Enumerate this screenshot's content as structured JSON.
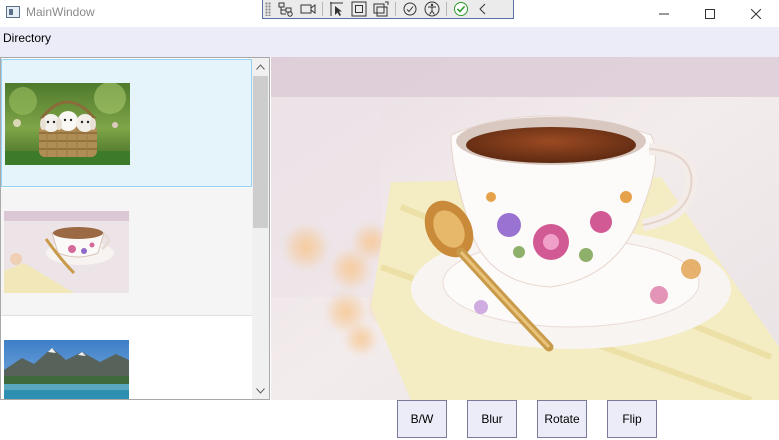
{
  "window": {
    "title": "MainWindow"
  },
  "menu": {
    "items": [
      {
        "label": "Directory"
      }
    ]
  },
  "debug_toolbar": {
    "icons": [
      "live-visual-tree-icon",
      "record-icon",
      "select-element-icon",
      "display-layout-adorner-icon",
      "track-focus-icon",
      "binding-failures-icon",
      "accessibility-icon",
      "checkmark-icon",
      "collapse-icon"
    ]
  },
  "image_list": {
    "items": [
      {
        "thumbnail": "puppies-in-basket",
        "selected": true
      },
      {
        "thumbnail": "teacup-on-saucer",
        "selected": false
      },
      {
        "thumbnail": "mountain-lake",
        "selected": false
      }
    ]
  },
  "preview": {
    "image": "teacup-on-saucer"
  },
  "actions": {
    "bw": "B/W",
    "blur": "Blur",
    "rotate": "Rotate",
    "flip": "Flip"
  }
}
